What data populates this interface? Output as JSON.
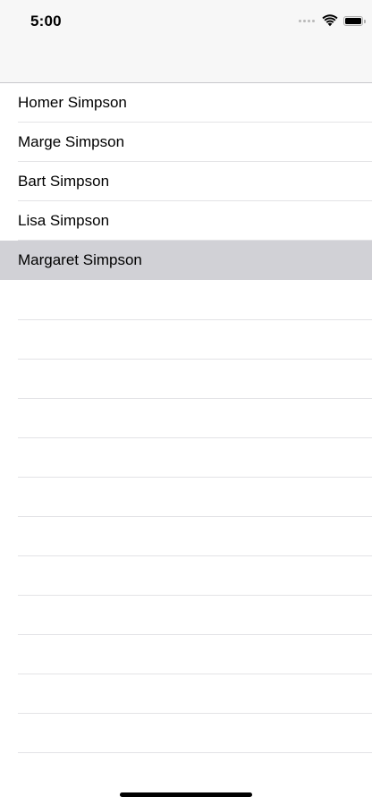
{
  "status_bar": {
    "time": "5:00",
    "battery_level": 1.0
  },
  "list": {
    "rows": [
      {
        "label": "Homer Simpson",
        "selected": false
      },
      {
        "label": "Marge Simpson",
        "selected": false
      },
      {
        "label": "Bart Simpson",
        "selected": false
      },
      {
        "label": "Lisa Simpson",
        "selected": false
      },
      {
        "label": "Margaret Simpson",
        "selected": true
      }
    ],
    "selection_color": "#d1d1d6",
    "separator_color": "#e3e3e6"
  },
  "icons": [
    "cellular-signal-icon",
    "wifi-icon",
    "battery-icon"
  ]
}
